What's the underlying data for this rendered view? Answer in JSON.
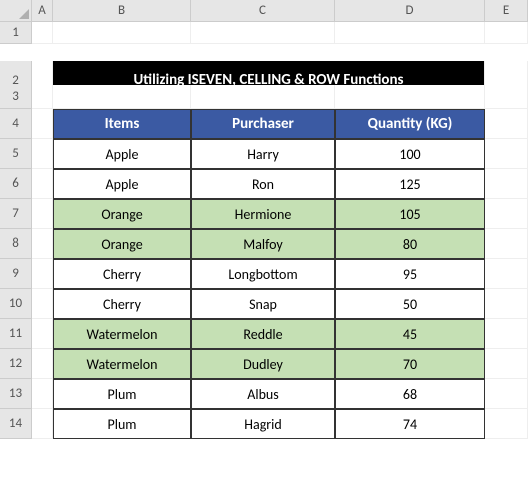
{
  "columns": {
    "A": "A",
    "B": "B",
    "C": "C",
    "D": "D",
    "E": "E"
  },
  "row_labels": [
    "1",
    "2",
    "3",
    "4",
    "5",
    "6",
    "7",
    "8",
    "9",
    "10",
    "11",
    "12",
    "13",
    "14"
  ],
  "title": "Utilizing ISEVEN, CELLING & ROW Functions",
  "headers": {
    "items": "Items",
    "purchaser": "Purchaser",
    "qty": "Quantity (KG)"
  },
  "rows": [
    {
      "items": "Apple",
      "purchaser": "Harry",
      "qty": "100",
      "shade": false
    },
    {
      "items": "Apple",
      "purchaser": "Ron",
      "qty": "125",
      "shade": false
    },
    {
      "items": "Orange",
      "purchaser": "Hermione",
      "qty": "105",
      "shade": true
    },
    {
      "items": "Orange",
      "purchaser": "Malfoy",
      "qty": "80",
      "shade": true
    },
    {
      "items": "Cherry",
      "purchaser": "Longbottom",
      "qty": "95",
      "shade": false
    },
    {
      "items": "Cherry",
      "purchaser": "Snap",
      "qty": "50",
      "shade": false
    },
    {
      "items": "Watermelon",
      "purchaser": "Reddle",
      "qty": "45",
      "shade": true
    },
    {
      "items": "Watermelon",
      "purchaser": "Dudley",
      "qty": "70",
      "shade": true
    },
    {
      "items": "Plum",
      "purchaser": "Albus",
      "qty": "68",
      "shade": false
    },
    {
      "items": "Plum",
      "purchaser": "Hagrid",
      "qty": "74",
      "shade": false
    }
  ]
}
